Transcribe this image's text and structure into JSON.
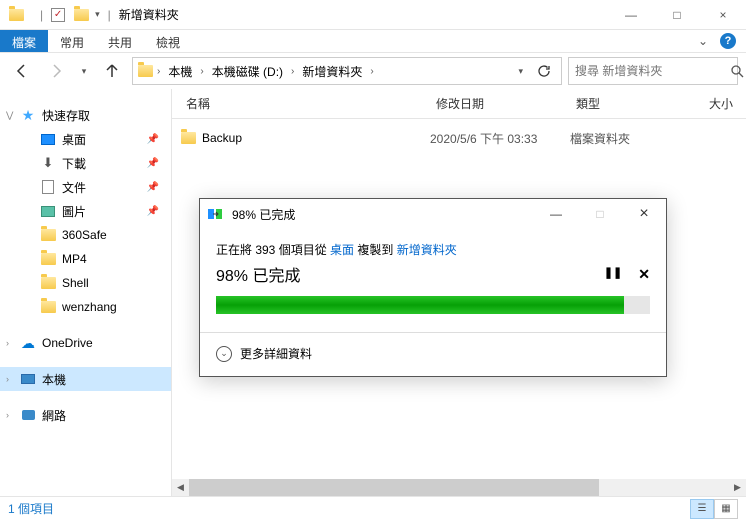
{
  "window": {
    "title": "新增資料夾",
    "min_label": "—",
    "max_label": "□",
    "close_label": "×"
  },
  "ribbon": {
    "file": "檔案",
    "home": "常用",
    "share": "共用",
    "view": "檢視"
  },
  "breadcrumbs": {
    "b0": "本機",
    "b1": "本機磁碟 (D:)",
    "b2": "新增資料夾"
  },
  "search": {
    "placeholder": "搜尋 新增資料夾"
  },
  "sidebar": {
    "quick_access": "快速存取",
    "desktop": "桌面",
    "downloads": "下載",
    "documents": "文件",
    "pictures": "圖片",
    "f1": "360Safe",
    "f2": "MP4",
    "f3": "Shell",
    "f4": "wenzhang",
    "onedrive": "OneDrive",
    "this_pc": "本機",
    "network": "網路"
  },
  "columns": {
    "name": "名稱",
    "date": "修改日期",
    "type": "類型",
    "size": "大小"
  },
  "rows": [
    {
      "name": "Backup",
      "date": "2020/5/6 下午 03:33",
      "type": "檔案資料夾"
    }
  ],
  "status": {
    "count": "1 個項目"
  },
  "dialog": {
    "title": "98% 已完成",
    "line1_prefix": "正在將 393 個項目從 ",
    "line1_src": "桌面",
    "line1_mid": " 複製到 ",
    "line1_dst": "新增資料夾",
    "line2": "98% 已完成",
    "progress_pct": 94,
    "details": "更多詳細資料",
    "pause": "❚❚",
    "cancel": "✕"
  }
}
